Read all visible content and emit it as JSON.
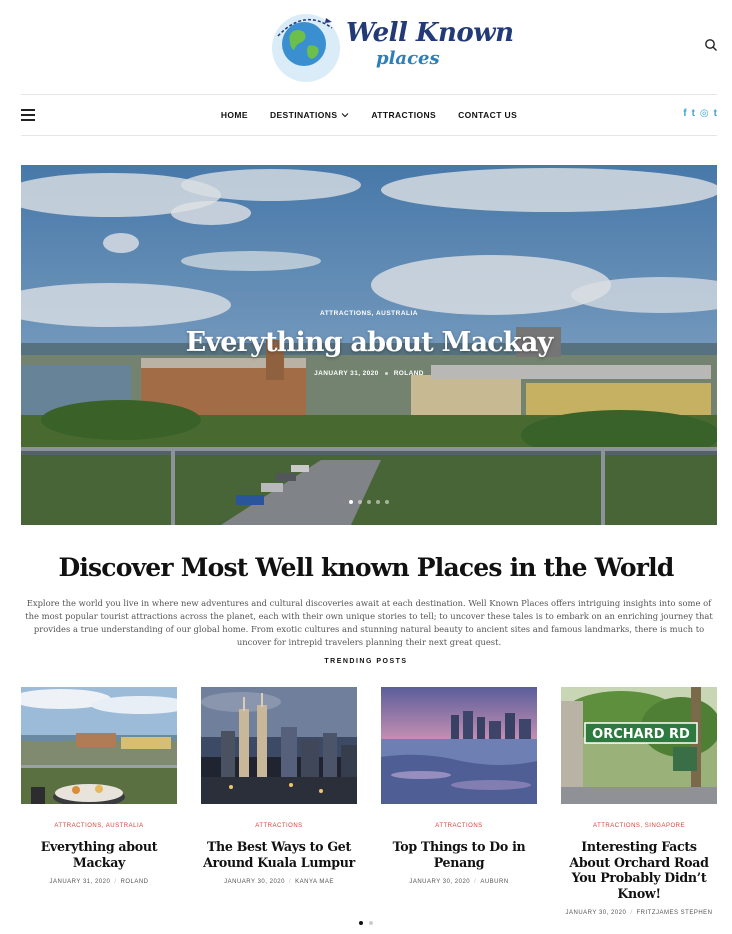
{
  "header": {
    "logo_line1": "Well Known",
    "logo_line2": "places",
    "search_icon": "search-icon"
  },
  "nav": {
    "menu_icon": "hamburger-icon",
    "items": [
      {
        "label": "HOME"
      },
      {
        "label": "DESTINATIONS",
        "dropdown": true
      },
      {
        "label": "ATTRACTIONS"
      },
      {
        "label": "CONTACT US"
      }
    ],
    "socials": [
      {
        "icon": "facebook-icon",
        "glyph": "f"
      },
      {
        "icon": "twitter-icon",
        "glyph": "t"
      },
      {
        "icon": "instagram-icon",
        "glyph": "◎"
      },
      {
        "icon": "tumblr-icon",
        "glyph": "t"
      }
    ]
  },
  "hero": {
    "categories": "ATTRACTIONS,   AUSTRALIA",
    "title": "Everything about Mackay",
    "date": "JANUARY 31, 2020",
    "author": "ROLAND",
    "slides": 5,
    "active_slide": 1
  },
  "intro": {
    "title": "Discover Most Well known Places in the World",
    "text": "Explore the world you live in where new adventures and cultural discoveries await at each destination. Well Known Places offers intriguing insights into some of the most popular tourist attractions across the planet, each with their own unique stories to tell; to uncover these tales is to embark on an enriching journey that provides a true understanding of our global home. From exotic cultures and stunning natural beauty to ancient sites and famous landmarks, there is much to uncover for intrepid travelers planning their next great quest.",
    "trending_label": "TRENDING POSTS"
  },
  "cards": [
    {
      "categories": "ATTRACTIONS,   AUSTRALIA",
      "title": "Everything about Mackay",
      "date": "JANUARY 31, 2020",
      "author": "ROLAND"
    },
    {
      "categories": "ATTRACTIONS",
      "title": "The Best Ways to Get Around Kuala Lumpur",
      "date": "JANUARY 30, 2020",
      "author": "KANYA MAE"
    },
    {
      "categories": "ATTRACTIONS",
      "title": "Top Things to Do in Penang",
      "date": "JANUARY 30, 2020",
      "author": "AUBURN"
    },
    {
      "categories": "ATTRACTIONS,   SINGAPORE",
      "title": "Interesting Facts About Orchard Road You Probably Didn’t Know!",
      "date": "JANUARY 30, 2020",
      "author": "FRITZJAMES STEPHEN",
      "sign_text": "ORCHARD RD"
    }
  ],
  "pager": {
    "pages": 2,
    "active": 1
  },
  "colors": {
    "accent": "#d9443b",
    "brand": "#233a78",
    "social": "#3aa2d6"
  }
}
